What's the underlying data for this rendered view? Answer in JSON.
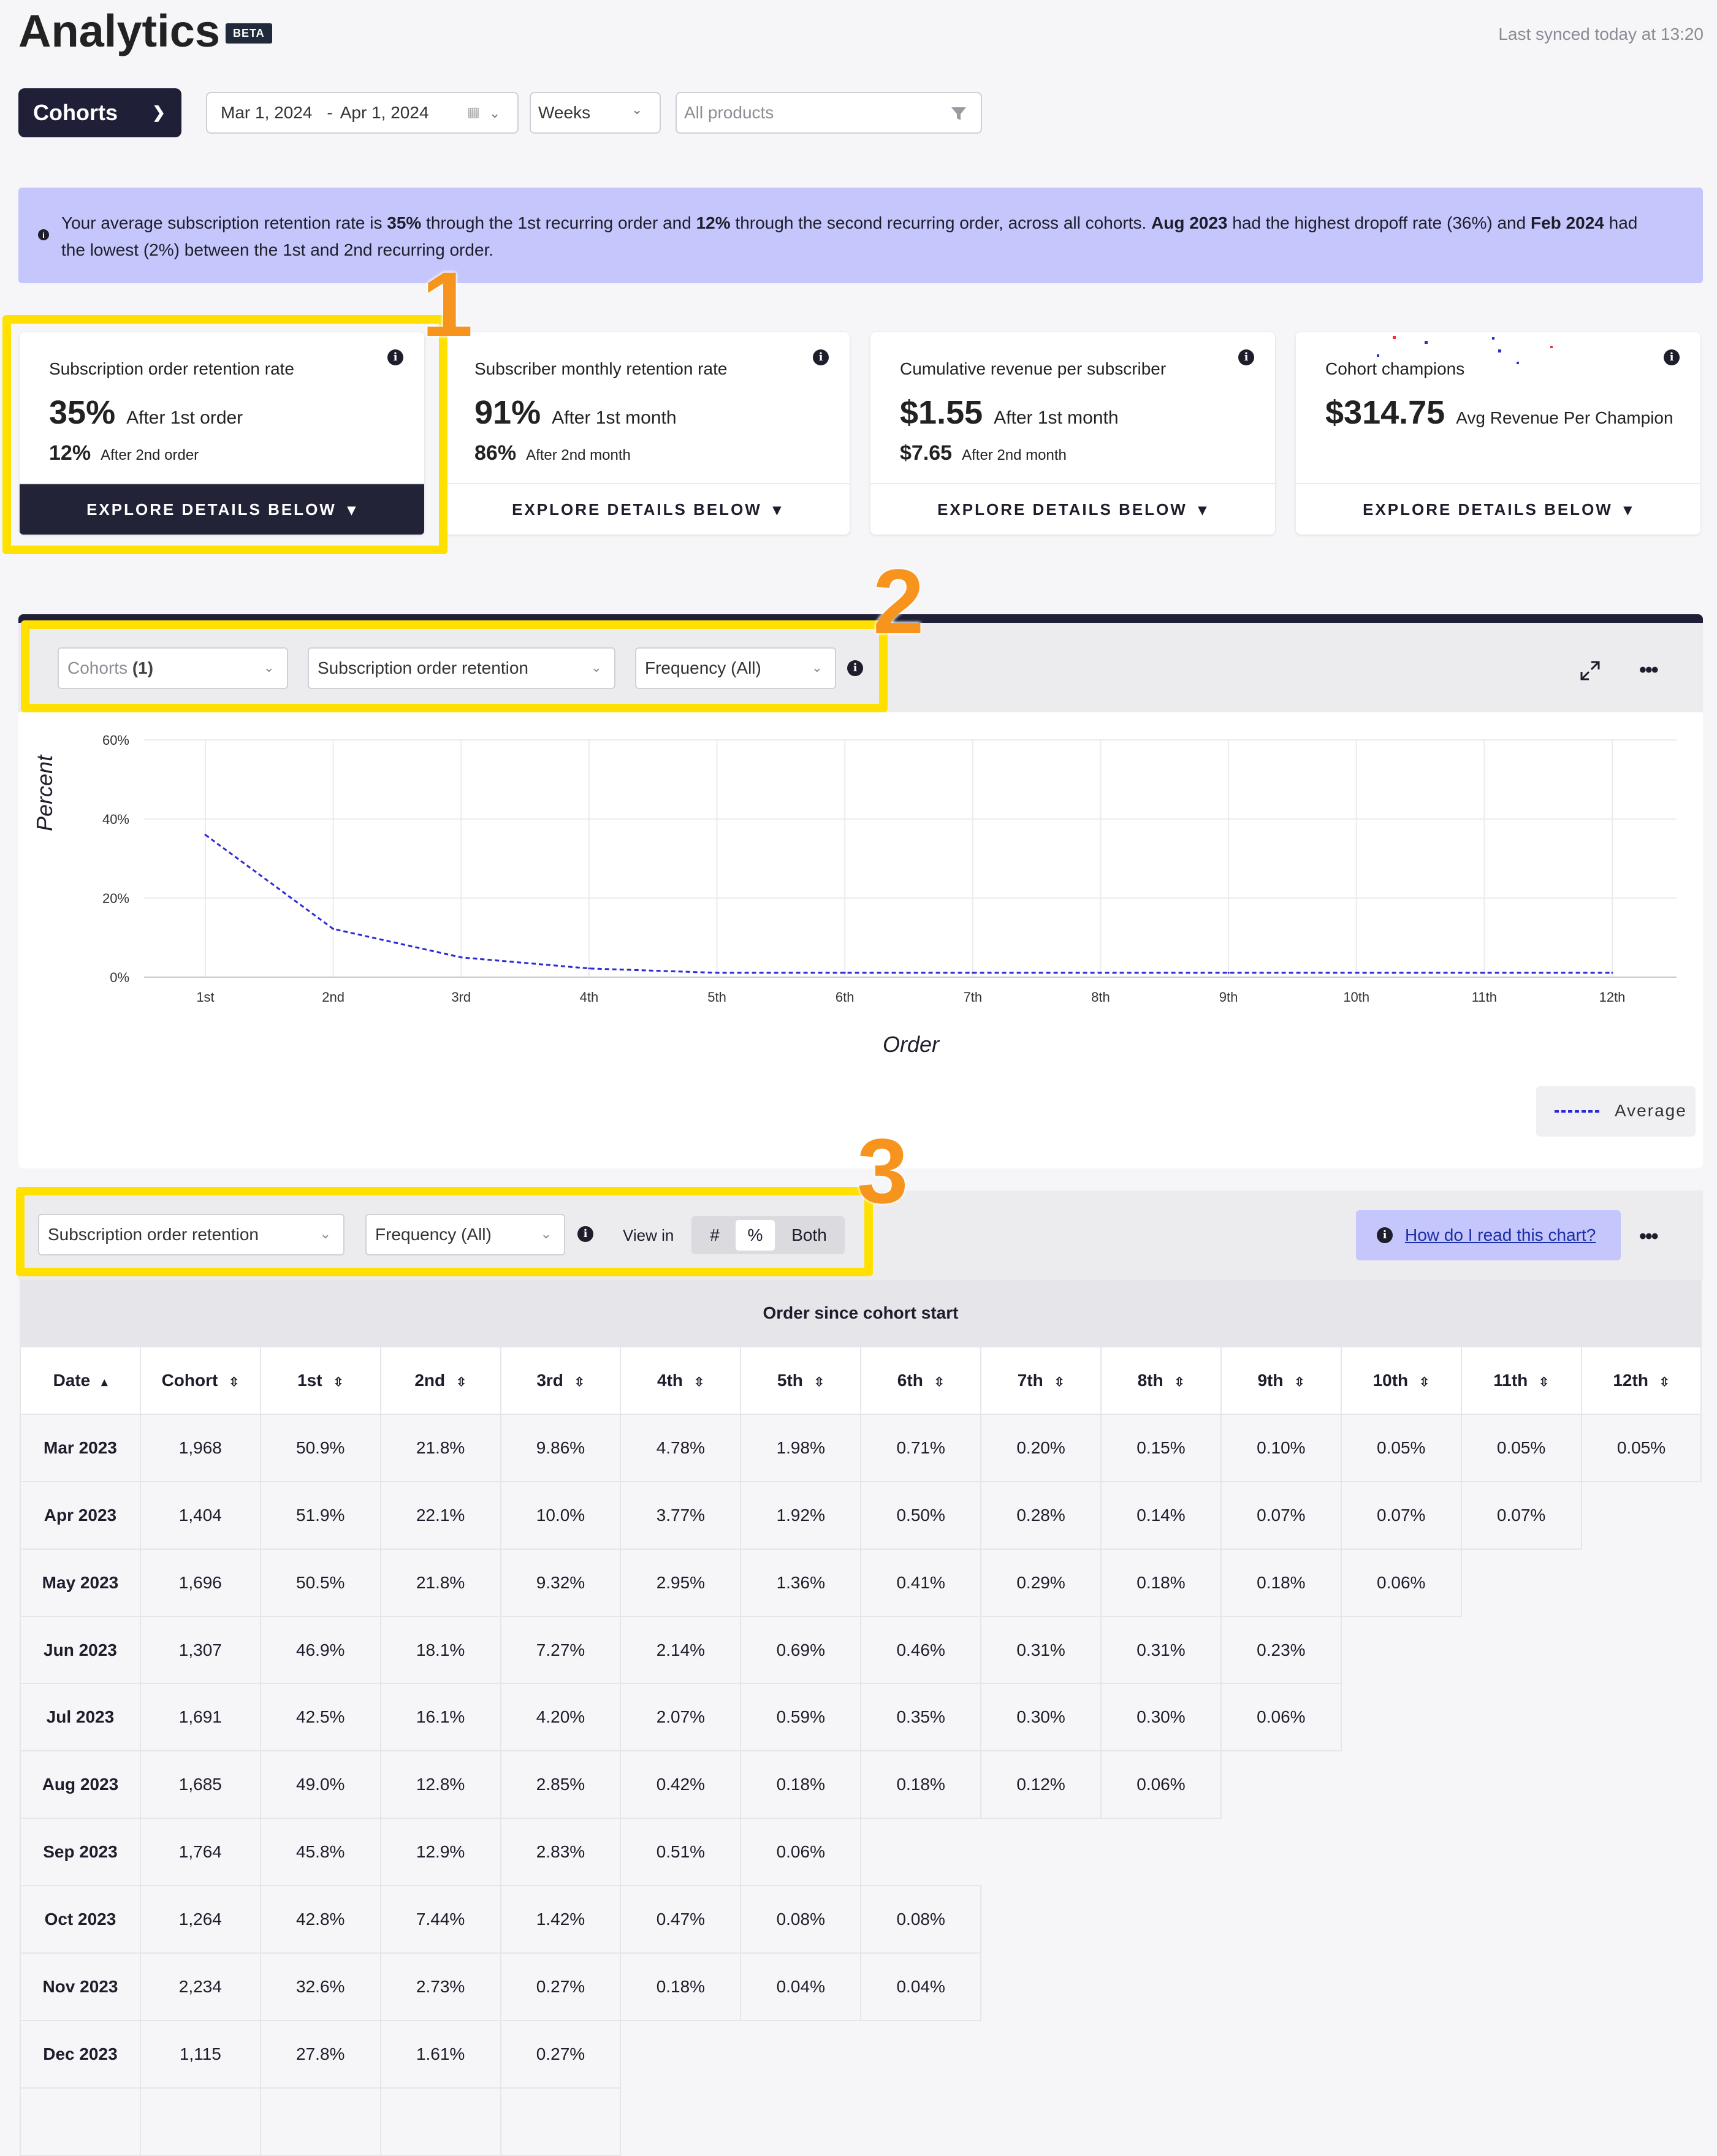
{
  "header": {
    "title": "Analytics",
    "beta": "BETA",
    "synced": "Last synced today at 13:20"
  },
  "filters": {
    "mode": "Cohorts",
    "date_start": "Mar 1, 2024",
    "date_sep": "-",
    "date_end": "Apr 1, 2024",
    "granularity": "Weeks",
    "products": "All products"
  },
  "banner": {
    "p1": "Your average subscription retention rate is ",
    "b1": "35%",
    "p2": " through the 1st recurring order and ",
    "b2": "12%",
    "p3": " through the second recurring order, across all cohorts. ",
    "b3": "Aug 2023",
    "p4": " had the highest dropoff rate (36%) and ",
    "b4": "Feb 2024",
    "p5": " had the lowest (2%) between the 1st and 2nd recurring order."
  },
  "cards": [
    {
      "title": "Subscription order retention rate",
      "big": "35%",
      "big_sub": "After 1st order",
      "small": "12%",
      "small_sub": "After 2nd order",
      "cta": "EXPLORE DETAILS BELOW"
    },
    {
      "title": "Subscriber monthly retention rate",
      "big": "91%",
      "big_sub": "After 1st month",
      "small": "86%",
      "small_sub": "After 2nd month",
      "cta": "EXPLORE DETAILS BELOW"
    },
    {
      "title": "Cumulative revenue per subscriber",
      "big": "$1.55",
      "big_sub": "After 1st month",
      "small": "$7.65",
      "small_sub": "After 2nd month",
      "cta": "EXPLORE DETAILS BELOW"
    },
    {
      "title": "Cohort champions",
      "big": "$314.75",
      "big_sub": "Avg Revenue Per Champion",
      "small": "",
      "small_sub": "",
      "cta": "EXPLORE DETAILS BELOW"
    }
  ],
  "annotations": {
    "n1": "1",
    "n2": "2",
    "n3": "3"
  },
  "chart_controls": {
    "cohorts_label": "Cohorts",
    "cohorts_count": "(1)",
    "metric": "Subscription order retention",
    "frequency": "Frequency (All)"
  },
  "chart_data": {
    "type": "line",
    "title": "",
    "xlabel": "Order",
    "ylabel": "Percent",
    "categories": [
      "1st",
      "2nd",
      "3rd",
      "4th",
      "5th",
      "6th",
      "7th",
      "8th",
      "9th",
      "10th",
      "11th",
      "12th"
    ],
    "ylim": [
      0,
      60
    ],
    "yticks": [
      "0%",
      "20%",
      "40%",
      "60%"
    ],
    "series": [
      {
        "name": "Average",
        "values": [
          36,
          12.2,
          5,
          2.2,
          1.1,
          1.1,
          1.1,
          1.1,
          1.1,
          1.1,
          1.1,
          1.1
        ],
        "color": "#2a2ad8",
        "style": "dashed"
      }
    ],
    "grid": true,
    "legend": "bottom-right"
  },
  "table_controls": {
    "metric": "Subscription order retention",
    "frequency": "Frequency (All)",
    "view_in": "View in",
    "opt_num": "#",
    "opt_pct": "%",
    "opt_both": "Both",
    "help": "How do I read this chart?"
  },
  "table": {
    "band": "Order since cohort start",
    "headers": [
      "Date",
      "Cohort",
      "1st",
      "2nd",
      "3rd",
      "4th",
      "5th",
      "6th",
      "7th",
      "8th",
      "9th",
      "10th",
      "11th",
      "12th"
    ],
    "rows": [
      [
        "Mar 2023",
        "1,968",
        "50.9%",
        "21.8%",
        "9.86%",
        "4.78%",
        "1.98%",
        "0.71%",
        "0.20%",
        "0.15%",
        "0.10%",
        "0.05%",
        "0.05%",
        "0.05%"
      ],
      [
        "Apr 2023",
        "1,404",
        "51.9%",
        "22.1%",
        "10.0%",
        "3.77%",
        "1.92%",
        "0.50%",
        "0.28%",
        "0.14%",
        "0.07%",
        "0.07%",
        "0.07%"
      ],
      [
        "May 2023",
        "1,696",
        "50.5%",
        "21.8%",
        "9.32%",
        "2.95%",
        "1.36%",
        "0.41%",
        "0.29%",
        "0.18%",
        "0.18%",
        "0.06%"
      ],
      [
        "Jun 2023",
        "1,307",
        "46.9%",
        "18.1%",
        "7.27%",
        "2.14%",
        "0.69%",
        "0.46%",
        "0.31%",
        "0.31%",
        "0.23%"
      ],
      [
        "Jul 2023",
        "1,691",
        "42.5%",
        "16.1%",
        "4.20%",
        "2.07%",
        "0.59%",
        "0.35%",
        "0.30%",
        "0.30%",
        "0.06%"
      ],
      [
        "Aug 2023",
        "1,685",
        "49.0%",
        "12.8%",
        "2.85%",
        "0.42%",
        "0.18%",
        "0.18%",
        "0.12%",
        "0.06%"
      ],
      [
        "Sep 2023",
        "1,764",
        "45.8%",
        "12.9%",
        "2.83%",
        "0.51%",
        "0.06%"
      ],
      [
        "Oct 2023",
        "1,264",
        "42.8%",
        "7.44%",
        "1.42%",
        "0.47%",
        "0.08%",
        "0.08%"
      ],
      [
        "Nov 2023",
        "2,234",
        "32.6%",
        "2.73%",
        "0.27%",
        "0.18%",
        "0.04%",
        "0.04%"
      ],
      [
        "Dec 2023",
        "1,115",
        "27.8%",
        "1.61%",
        "0.27%"
      ],
      [
        "",
        "",
        "",
        "",
        ""
      ]
    ]
  }
}
